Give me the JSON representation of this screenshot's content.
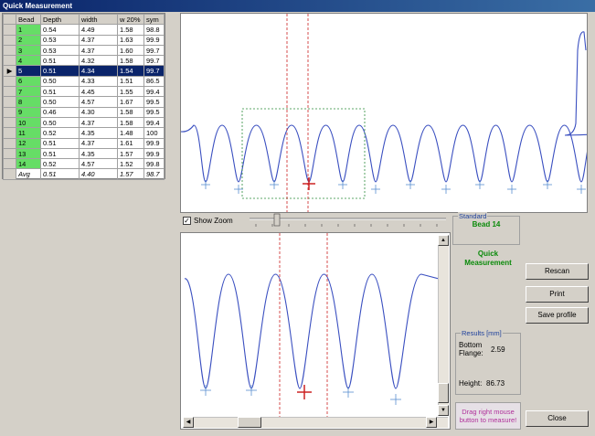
{
  "window": {
    "title": "Quick Measurement"
  },
  "table": {
    "columns": [
      "Bead",
      "Depth",
      "width",
      "w 20%",
      "sym"
    ],
    "rows": [
      [
        "1",
        "0.54",
        "4.49",
        "1.58",
        "98.8"
      ],
      [
        "2",
        "0.53",
        "4.37",
        "1.63",
        "99.9"
      ],
      [
        "3",
        "0.53",
        "4.37",
        "1.60",
        "99.7"
      ],
      [
        "4",
        "0.51",
        "4.32",
        "1.58",
        "99.7"
      ],
      [
        "5",
        "0.51",
        "4.34",
        "1.54",
        "99.7"
      ],
      [
        "6",
        "0.50",
        "4.33",
        "1.51",
        "86.5"
      ],
      [
        "7",
        "0.51",
        "4.45",
        "1.55",
        "99.4"
      ],
      [
        "8",
        "0.50",
        "4.57",
        "1.67",
        "99.5"
      ],
      [
        "9",
        "0.46",
        "4.30",
        "1.58",
        "99.5"
      ],
      [
        "10",
        "0.50",
        "4.37",
        "1.58",
        "99.4"
      ],
      [
        "11",
        "0.52",
        "4.35",
        "1.48",
        "100"
      ],
      [
        "12",
        "0.51",
        "4.37",
        "1.61",
        "99.9"
      ],
      [
        "13",
        "0.51",
        "4.35",
        "1.57",
        "99.9"
      ],
      [
        "14",
        "0.52",
        "4.57",
        "1.52",
        "99.8"
      ]
    ],
    "selected_row": 4,
    "avg": [
      "Avg",
      "0.51",
      "4.40",
      "1.57",
      "98.7"
    ]
  },
  "zoom": {
    "checkbox_label": "Show Zoom",
    "checked": true,
    "check_glyph": "✓"
  },
  "standard": {
    "title": "Standard",
    "value": "Bead 14"
  },
  "mode_label": "Quick\nMeasurement",
  "buttons": {
    "rescan": "Rescan",
    "print": "Print",
    "save_profile": "Save profile",
    "close": "Close"
  },
  "results": {
    "title": "Results [mm]",
    "bottom_flange_label": "Bottom\nFlange:",
    "bottom_flange_value": "2.59",
    "height_label": "Height:",
    "height_value": "86.73"
  },
  "hint": "Drag right mouse button to measure!",
  "colors": {
    "profile": "#3a4fc0",
    "cursor": "#cc2222",
    "marker": "#5a8fd0",
    "zoom_box": "#2a8a3a"
  }
}
